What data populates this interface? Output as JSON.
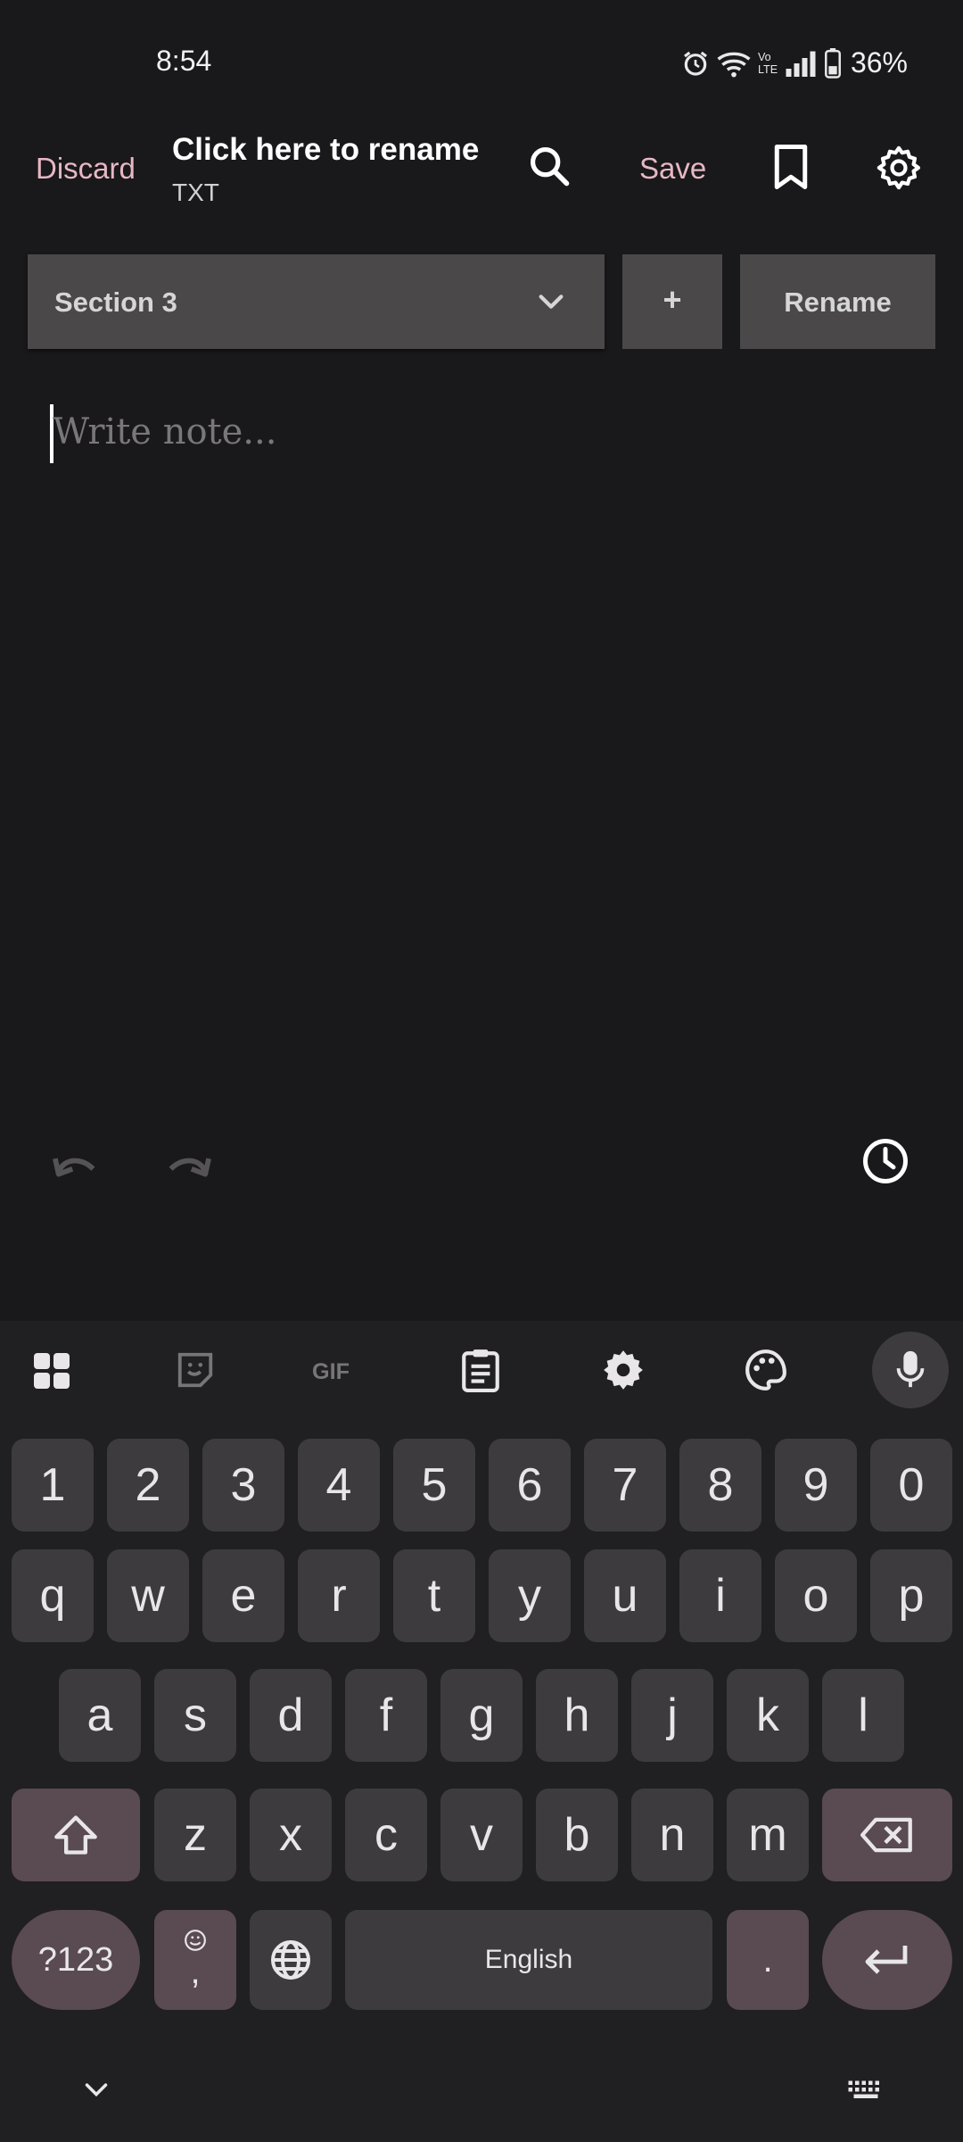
{
  "status_bar": {
    "time": "8:54",
    "battery": "36%"
  },
  "app_bar": {
    "discard": "Discard",
    "title": "Click here to rename",
    "subtitle": "TXT",
    "save": "Save"
  },
  "section_bar": {
    "selected": "Section 3",
    "add": "+",
    "rename": "Rename"
  },
  "editor": {
    "placeholder": "Write note..."
  },
  "keyboard": {
    "numbers": [
      "1",
      "2",
      "3",
      "4",
      "5",
      "6",
      "7",
      "8",
      "9",
      "0"
    ],
    "row1": [
      "q",
      "w",
      "e",
      "r",
      "t",
      "y",
      "u",
      "i",
      "o",
      "p"
    ],
    "row2": [
      "a",
      "s",
      "d",
      "f",
      "g",
      "h",
      "j",
      "k",
      "l"
    ],
    "row3": [
      "z",
      "x",
      "c",
      "v",
      "b",
      "n",
      "m"
    ],
    "symbols": "?123",
    "comma": ",",
    "space": "English",
    "period": "."
  }
}
